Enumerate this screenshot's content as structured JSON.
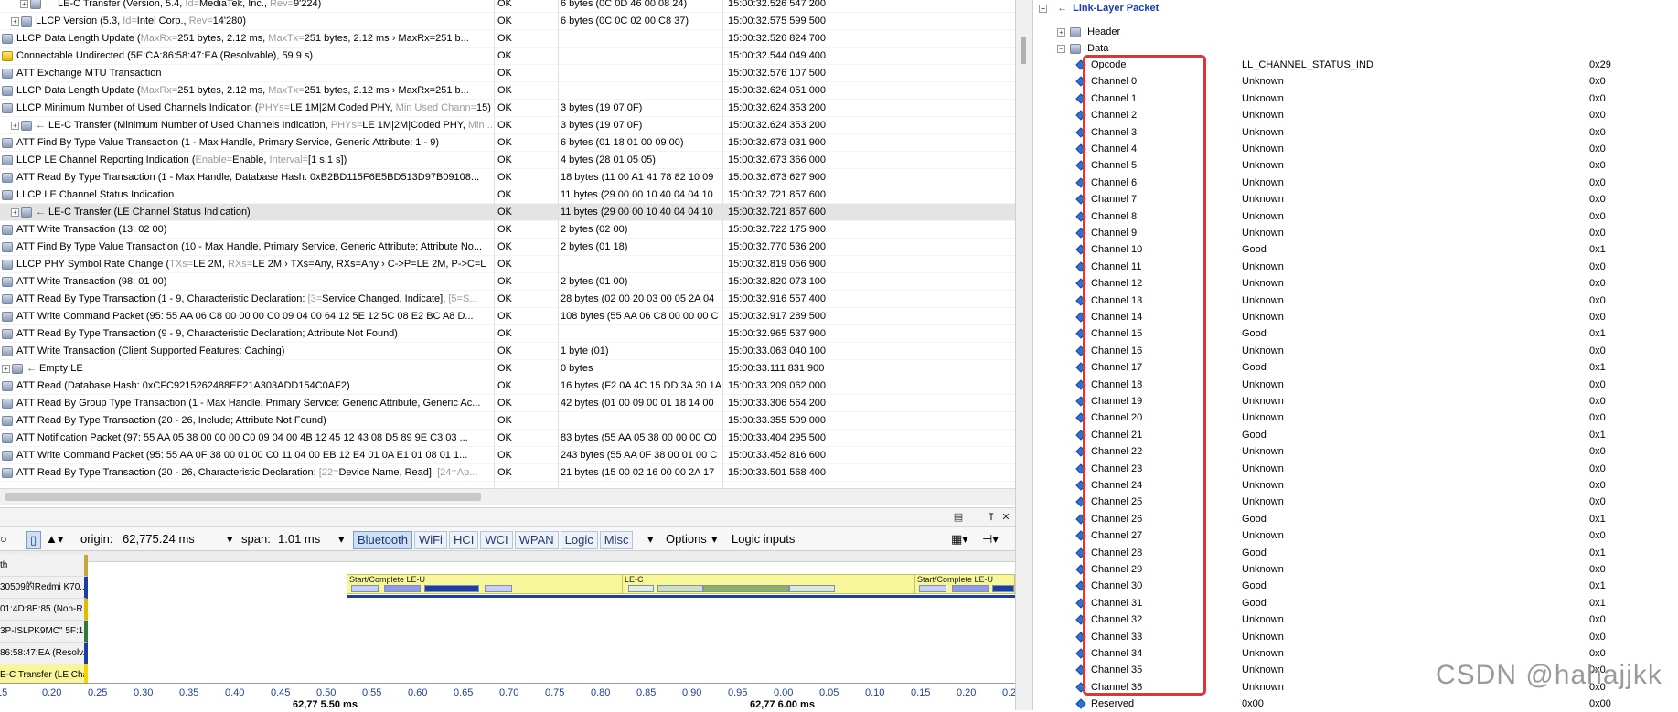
{
  "transactions": [
    {
      "indent": 2,
      "expand": "+",
      "icon": "arrow",
      "name": "LE-C Transfer (Version, 5.4, ",
      "gray": "Id=",
      "name2": "MediaTek, Inc., ",
      "gray2": "Rev=",
      "name3": "9'224)",
      "status": "OK",
      "data": "6 bytes (0C 0D 46 00 08 24)",
      "time": "15:00:32.526 547 200"
    },
    {
      "indent": 1,
      "expand": "+",
      "icon": "ic",
      "name": "LLCP Version (5.3, ",
      "gray": "Id=",
      "name2": "Intel Corp., ",
      "gray2": "Rev=",
      "name3": "14'280)",
      "status": "OK",
      "data": "6 bytes (0C 0C 02 00 C8 37)",
      "time": "15:00:32.575 599 500"
    },
    {
      "indent": 0,
      "expand": "",
      "icon": "ic",
      "name": "LLCP Data Length Update (",
      "gray": "MaxRx=",
      "name2": "251 bytes, 2.12 ms, ",
      "gray2": "MaxTx=",
      "name3": "251 bytes, 2.12 ms › MaxRx=251 b...",
      "status": "OK",
      "data": "",
      "time": "15:00:32.526 824 700"
    },
    {
      "indent": 0,
      "expand": "",
      "icon": "warn",
      "name": "Connectable Undirected (5E:CA:86:58:47:EA (Resolvable), 59.9 s)",
      "gray": "",
      "name2": "",
      "gray2": "",
      "name3": "",
      "status": "OK",
      "data": "",
      "time": "15:00:32.544 049 400"
    },
    {
      "indent": 0,
      "expand": "",
      "icon": "ic",
      "name": "ATT Exchange MTU Transaction",
      "gray": "",
      "name2": "",
      "gray2": "",
      "name3": "",
      "status": "OK",
      "data": "",
      "time": "15:00:32.576 107 500"
    },
    {
      "indent": 0,
      "expand": "",
      "icon": "ic",
      "name": "LLCP Data Length Update (",
      "gray": "MaxRx=",
      "name2": "251 bytes, 2.12 ms, ",
      "gray2": "MaxTx=",
      "name3": "251 bytes, 2.12 ms › MaxRx=251 b...",
      "status": "OK",
      "data": "",
      "time": "15:00:32.624 051 000"
    },
    {
      "indent": 0,
      "expand": "",
      "icon": "ic",
      "name": "LLCP Minimum Number of Used Channels Indication (",
      "gray": "PHYs=",
      "name2": "LE 1M|2M|Coded PHY, ",
      "gray2": "Min Used Chann=",
      "name3": "15)",
      "status": "OK",
      "data": "3 bytes (19 07 0F)",
      "time": "15:00:32.624 353 200"
    },
    {
      "indent": 1,
      "expand": "+",
      "icon": "arrow",
      "name": "LE-C Transfer (Minimum Number of Used Channels Indication, ",
      "gray": "PHYs=",
      "name2": "LE 1M|2M|Coded PHY, ",
      "gray2": "Min ...",
      "name3": "",
      "status": "OK",
      "data": "3 bytes (19 07 0F)",
      "time": "15:00:32.624 353 200"
    },
    {
      "indent": 0,
      "expand": "",
      "icon": "ic",
      "name": "ATT Find By Type Value Transaction (1 - Max Handle, Primary Service, Generic Attribute: 1 - 9)",
      "gray": "",
      "name2": "",
      "gray2": "",
      "name3": "",
      "status": "OK",
      "data": "6 bytes (01 18 01 00 09 00)",
      "time": "15:00:32.673 031 900"
    },
    {
      "indent": 0,
      "expand": "",
      "icon": "ic",
      "name": "LLCP LE Channel Reporting Indication (",
      "gray": "Enable=",
      "name2": "Enable, ",
      "gray2": "Interval=",
      "name3": "[1 s,1 s])",
      "status": "OK",
      "data": "4 bytes (28 01 05 05)",
      "time": "15:00:32.673 366 000"
    },
    {
      "indent": 0,
      "expand": "",
      "icon": "ic",
      "name": "ATT Read By Type Transaction (1 - Max Handle, Database Hash: 0xB2BD115F6E5BD513D97B09108...",
      "gray": "",
      "name2": "",
      "gray2": "",
      "name3": "",
      "status": "OK",
      "data": "18 bytes (11 00 A1 41 78 82 10 09",
      "time": "15:00:32.673 627 900"
    },
    {
      "indent": 0,
      "expand": "",
      "icon": "ic",
      "name": "LLCP LE Channel Status Indication",
      "gray": "",
      "name2": "",
      "gray2": "",
      "name3": "",
      "status": "OK",
      "data": "11 bytes (29 00 00 10 40 04 04 10",
      "time": "15:00:32.721 857 600"
    },
    {
      "indent": 1,
      "expand": "+",
      "icon": "arrow",
      "name": "LE-C Transfer (LE Channel Status Indication)",
      "gray": "",
      "name2": "",
      "gray2": "",
      "name3": "",
      "status": "OK",
      "data": "11 bytes (29 00 00 10 40 04 04 10",
      "time": "15:00:32.721 857 600",
      "selected": true
    },
    {
      "indent": 0,
      "expand": "",
      "icon": "ic",
      "name": "ATT Write Transaction (13: 02 00)",
      "gray": "",
      "name2": "",
      "gray2": "",
      "name3": "",
      "status": "OK",
      "data": "2 bytes (02 00)",
      "time": "15:00:32.722 175 900"
    },
    {
      "indent": 0,
      "expand": "",
      "icon": "ic",
      "name": "ATT Find By Type Value Transaction (10 - Max Handle, Primary Service, Generic Attribute; Attribute No...",
      "gray": "",
      "name2": "",
      "gray2": "",
      "name3": "",
      "status": "OK",
      "data": "2 bytes (01 18)",
      "time": "15:00:32.770 536 200"
    },
    {
      "indent": 0,
      "expand": "",
      "icon": "ic",
      "name": "LLCP PHY Symbol Rate Change (",
      "gray": "TXs=",
      "name2": "LE 2M, ",
      "gray2": "RXs=",
      "name3": "LE 2M › TXs=Any, RXs=Any › C->P=LE 2M, P->C=L",
      "status": "OK",
      "data": "",
      "time": "15:00:32.819 056 900"
    },
    {
      "indent": 0,
      "expand": "",
      "icon": "ic",
      "name": "ATT Write Transaction (98: 01 00)",
      "gray": "",
      "name2": "",
      "gray2": "",
      "name3": "",
      "status": "OK",
      "data": "2 bytes (01 00)",
      "time": "15:00:32.820 073 100"
    },
    {
      "indent": 0,
      "expand": "",
      "icon": "ic",
      "name": "ATT Read By Type Transaction (1 - 9, Characteristic Declaration: ",
      "gray": "[3=",
      "name2": "Service Changed, Indicate], ",
      "gray2": "[5=S...",
      "name3": "",
      "status": "OK",
      "data": "28 bytes (02 00 20 03 00 05 2A 04",
      "time": "15:00:32.916 557 400"
    },
    {
      "indent": 0,
      "expand": "",
      "icon": "ic",
      "name": "ATT Write Command Packet (95: 55 AA 06 C8 00 00 00 C0 09 04 00 64 12 5E 12 5C 08 E2 BC A8 D...",
      "gray": "",
      "name2": "",
      "gray2": "",
      "name3": "",
      "status": "OK",
      "data": "108 bytes (55 AA 06 C8 00 00 00 C",
      "time": "15:00:32.917 289 500"
    },
    {
      "indent": 0,
      "expand": "",
      "icon": "ic",
      "name": "ATT Read By Type Transaction (9 - 9, Characteristic Declaration; Attribute Not Found)",
      "gray": "",
      "name2": "",
      "gray2": "",
      "name3": "",
      "status": "OK",
      "data": "",
      "time": "15:00:32.965 537 900"
    },
    {
      "indent": 0,
      "expand": "",
      "icon": "ic",
      "name": "ATT Write Transaction (Client Supported Features: Caching)",
      "gray": "",
      "name2": "",
      "gray2": "",
      "name3": "",
      "status": "OK",
      "data": "1 byte (01)",
      "time": "15:00:33.063 040 100"
    },
    {
      "indent": 0,
      "expand": "+",
      "icon": "arrow",
      "name": "Empty LE",
      "gray": "",
      "name2": "",
      "gray2": "",
      "name3": "",
      "status": "OK",
      "data": "0 bytes",
      "time": "15:00:33.111 831 900"
    },
    {
      "indent": 0,
      "expand": "",
      "icon": "ic",
      "name": "ATT Read (Database Hash: 0xCFC9215262488EF21A303ADD154C0AF2)",
      "gray": "",
      "name2": "",
      "gray2": "",
      "name3": "",
      "status": "OK",
      "data": "16 bytes (F2 0A 4C 15 DD 3A 30 1A",
      "time": "15:00:33.209 062 000"
    },
    {
      "indent": 0,
      "expand": "",
      "icon": "ic",
      "name": "ATT Read By Group Type Transaction (1 - Max Handle, Primary Service: Generic Attribute, Generic Ac...",
      "gray": "",
      "name2": "",
      "gray2": "",
      "name3": "",
      "status": "OK",
      "data": "42 bytes (01 00 09 00 01 18 14 00",
      "time": "15:00:33.306 564 200"
    },
    {
      "indent": 0,
      "expand": "",
      "icon": "ic",
      "name": "ATT Read By Type Transaction (20 - 26, Include; Attribute Not Found)",
      "gray": "",
      "name2": "",
      "gray2": "",
      "name3": "",
      "status": "OK",
      "data": "",
      "time": "15:00:33.355 509 000"
    },
    {
      "indent": 0,
      "expand": "",
      "icon": "ic",
      "name": "ATT Notification Packet (97: 55 AA 05 38 00 00 00 C0 09 04 00 4B 12 45 12 43 08 D5 89 9E C3 03 ...",
      "gray": "",
      "name2": "",
      "gray2": "",
      "name3": "",
      "status": "OK",
      "data": "83 bytes (55 AA 05 38 00 00 00 C0",
      "time": "15:00:33.404 295 500"
    },
    {
      "indent": 0,
      "expand": "",
      "icon": "ic",
      "name": "ATT Write Command Packet (95: 55 AA 0F 38 00 01 00 C0 11 04 00 EB 12 E4 01 0A E1 01 08 01 1...",
      "gray": "",
      "name2": "",
      "gray2": "",
      "name3": "",
      "status": "OK",
      "data": "243 bytes (55 AA 0F 38 00 01 00 C",
      "time": "15:00:33.452 816 600"
    },
    {
      "indent": 0,
      "expand": "",
      "icon": "ic",
      "name": "ATT Read By Type Transaction (20 - 26, Characteristic Declaration: ",
      "gray": "[22=",
      "name2": "Device Name, Read], ",
      "gray2": "[24=Ap...",
      "name3": "",
      "status": "OK",
      "data": "21 bytes (15 00 02 16 00 00 2A 17",
      "time": "15:00:33.501 568 400"
    }
  ],
  "toolbar": {
    "origin_label": "origin:",
    "origin_value": "62,775.24 ms",
    "span_label": "span:",
    "span_value": "1.01 ms",
    "tabs": [
      "Bluetooth",
      "WiFi",
      "HCI",
      "WCI",
      "WPAN",
      "Logic",
      "Misc"
    ],
    "options_label": "Options",
    "logic_inputs_label": "Logic inputs"
  },
  "timeline": {
    "rows": [
      "th",
      "30509的Redmi K70...",
      "01:4D:8E:85 (Non-R...",
      "3P-ISLPK9MC\" 5F:1E...",
      "86:58:47:EA (Resolv...",
      "E-C Transfer (LE Cha..."
    ],
    "bands": [
      {
        "label": "Start/Complete LE-U"
      },
      {
        "label": "LE-C"
      },
      {
        "label": "Start/Complete LE-U"
      }
    ],
    "ticks": [
      "15",
      "0.20",
      "0.25",
      "0.30",
      "0.35",
      "0.40",
      "0.45",
      "0.50",
      "0.55",
      "0.60",
      "0.65",
      "0.70",
      "0.75",
      "0.80",
      "0.85",
      "0.90",
      "0.95",
      "0.00",
      "0.05",
      "0.10",
      "0.15",
      "0.20",
      "0.25"
    ],
    "major1": "62,77 5.50  ms",
    "major2": "62,77 6.00  ms"
  },
  "packet": {
    "title": "Link-Layer Packet",
    "header_label": "Header",
    "data_label": "Data",
    "fields": [
      {
        "name": "Opcode",
        "value": "LL_CHANNEL_STATUS_IND",
        "hex": "0x29"
      },
      {
        "name": "Channel 0",
        "value": "Unknown",
        "hex": "0x0"
      },
      {
        "name": "Channel 1",
        "value": "Unknown",
        "hex": "0x0"
      },
      {
        "name": "Channel 2",
        "value": "Unknown",
        "hex": "0x0"
      },
      {
        "name": "Channel 3",
        "value": "Unknown",
        "hex": "0x0"
      },
      {
        "name": "Channel 4",
        "value": "Unknown",
        "hex": "0x0"
      },
      {
        "name": "Channel 5",
        "value": "Unknown",
        "hex": "0x0"
      },
      {
        "name": "Channel 6",
        "value": "Unknown",
        "hex": "0x0"
      },
      {
        "name": "Channel 7",
        "value": "Unknown",
        "hex": "0x0"
      },
      {
        "name": "Channel 8",
        "value": "Unknown",
        "hex": "0x0"
      },
      {
        "name": "Channel 9",
        "value": "Unknown",
        "hex": "0x0"
      },
      {
        "name": "Channel 10",
        "value": "Good",
        "hex": "0x1"
      },
      {
        "name": "Channel 11",
        "value": "Unknown",
        "hex": "0x0"
      },
      {
        "name": "Channel 12",
        "value": "Unknown",
        "hex": "0x0"
      },
      {
        "name": "Channel 13",
        "value": "Unknown",
        "hex": "0x0"
      },
      {
        "name": "Channel 14",
        "value": "Unknown",
        "hex": "0x0"
      },
      {
        "name": "Channel 15",
        "value": "Good",
        "hex": "0x1"
      },
      {
        "name": "Channel 16",
        "value": "Unknown",
        "hex": "0x0"
      },
      {
        "name": "Channel 17",
        "value": "Good",
        "hex": "0x1"
      },
      {
        "name": "Channel 18",
        "value": "Unknown",
        "hex": "0x0"
      },
      {
        "name": "Channel 19",
        "value": "Unknown",
        "hex": "0x0"
      },
      {
        "name": "Channel 20",
        "value": "Unknown",
        "hex": "0x0"
      },
      {
        "name": "Channel 21",
        "value": "Good",
        "hex": "0x1"
      },
      {
        "name": "Channel 22",
        "value": "Unknown",
        "hex": "0x0"
      },
      {
        "name": "Channel 23",
        "value": "Unknown",
        "hex": "0x0"
      },
      {
        "name": "Channel 24",
        "value": "Unknown",
        "hex": "0x0"
      },
      {
        "name": "Channel 25",
        "value": "Unknown",
        "hex": "0x0"
      },
      {
        "name": "Channel 26",
        "value": "Good",
        "hex": "0x1"
      },
      {
        "name": "Channel 27",
        "value": "Unknown",
        "hex": "0x0"
      },
      {
        "name": "Channel 28",
        "value": "Good",
        "hex": "0x1"
      },
      {
        "name": "Channel 29",
        "value": "Unknown",
        "hex": "0x0"
      },
      {
        "name": "Channel 30",
        "value": "Good",
        "hex": "0x1"
      },
      {
        "name": "Channel 31",
        "value": "Good",
        "hex": "0x1"
      },
      {
        "name": "Channel 32",
        "value": "Unknown",
        "hex": "0x0"
      },
      {
        "name": "Channel 33",
        "value": "Unknown",
        "hex": "0x0"
      },
      {
        "name": "Channel 34",
        "value": "Unknown",
        "hex": "0x0"
      },
      {
        "name": "Channel 35",
        "value": "Unknown",
        "hex": "0x0"
      },
      {
        "name": "Channel 36",
        "value": "Unknown",
        "hex": "0x0"
      },
      {
        "name": "Reserved",
        "value": "0x00",
        "hex": "0x00"
      }
    ]
  },
  "watermark": "CSDN @hahajjkk",
  "colors": {
    "accent": "#1a3fa0",
    "highlight_box": "#e03535",
    "good": "#1a8c2a"
  }
}
